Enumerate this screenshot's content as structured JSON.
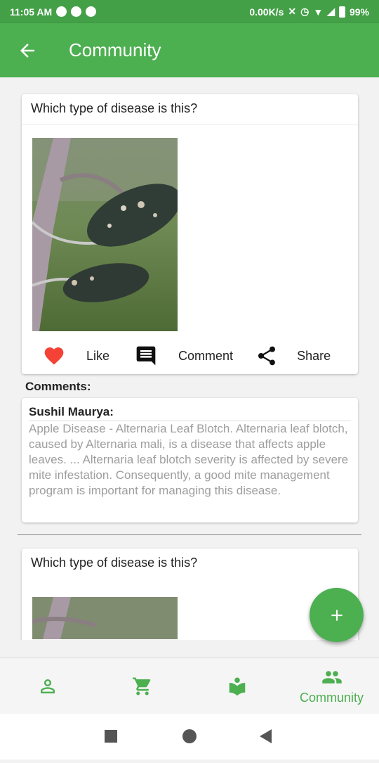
{
  "status": {
    "time": "11:05 AM",
    "speed": "0.00K/s",
    "battery": "99%"
  },
  "header": {
    "title": "Community"
  },
  "posts": [
    {
      "question": "Which type of disease is this?",
      "actions": {
        "like": "Like",
        "comment": "Comment",
        "share": "Share"
      }
    },
    {
      "question": "Which type of disease is this?"
    }
  ],
  "comments": {
    "label": "Comments:",
    "items": [
      {
        "author": "Sushil Maurya:",
        "text": "Apple Disease - Alternaria Leaf Blotch. Alternaria leaf blotch, caused by Alternaria mali, is a disease that affects apple leaves. ... Alternaria leaf blotch severity is affected by severe mite infestation. Consequently, a good mite management program is important for managing this disease."
      }
    ]
  },
  "bottom_nav": {
    "active": "community",
    "community_label": "Community"
  },
  "colors": {
    "primary": "#4caf50",
    "like": "#f44336"
  },
  "icons": [
    "back-arrow-icon",
    "heart-icon",
    "comment-icon",
    "share-icon",
    "plus-icon",
    "person-icon",
    "cart-icon",
    "book-icon",
    "people-icon"
  ]
}
